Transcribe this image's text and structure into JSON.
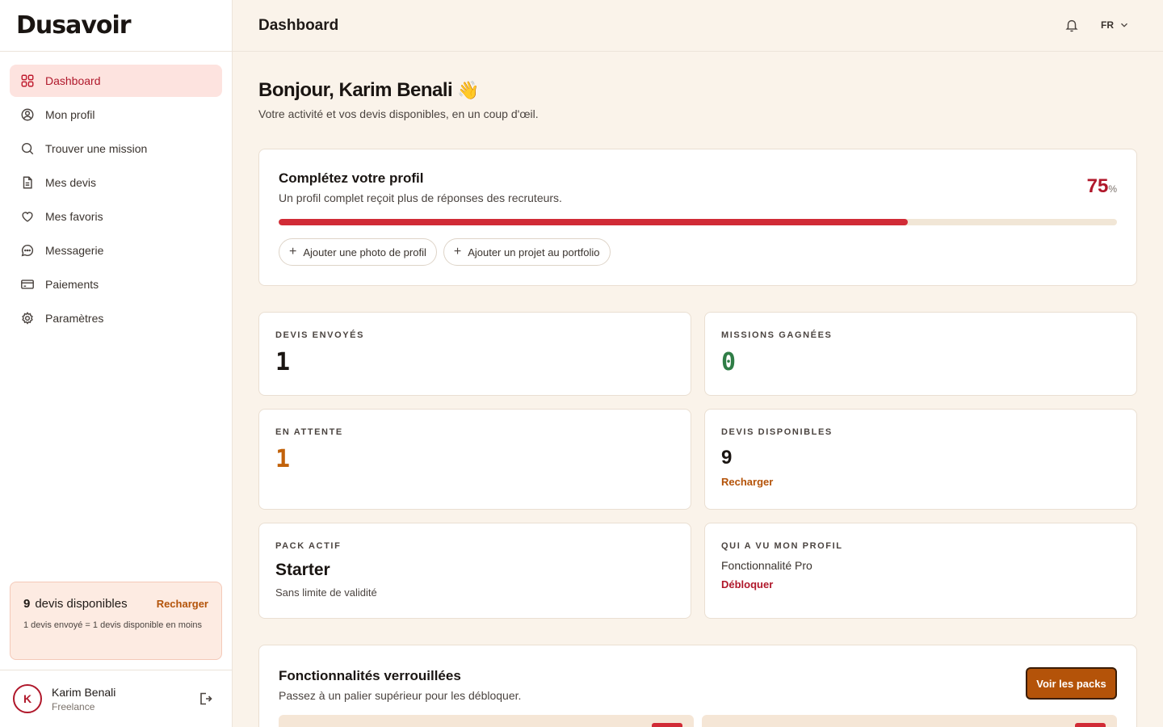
{
  "brand": {
    "logo": "Dusavoir"
  },
  "sidebar": {
    "items": [
      {
        "label": "Dashboard",
        "icon": "grid-icon",
        "active": true
      },
      {
        "label": "Mon profil",
        "icon": "user-circle-icon"
      },
      {
        "label": "Trouver une mission",
        "icon": "search-icon"
      },
      {
        "label": "Mes devis",
        "icon": "document-icon"
      },
      {
        "label": "Mes favoris",
        "icon": "heart-icon"
      },
      {
        "label": "Messagerie",
        "icon": "chat-icon"
      },
      {
        "label": "Paiements",
        "icon": "credit-card-icon"
      },
      {
        "label": "Paramètres",
        "icon": "gear-icon"
      }
    ],
    "credits": {
      "count": "9",
      "label": "devis disponibles",
      "link": "Recharger",
      "note": "1 devis envoyé = 1 devis disponible en moins"
    },
    "user": {
      "initial": "K",
      "name": "Karim Benali",
      "role": "Freelance"
    }
  },
  "header": {
    "title": "Dashboard",
    "lang": "FR"
  },
  "main": {
    "greeting": "Bonjour, Karim Benali",
    "greeting_emoji": "👋",
    "subtitle": "Votre activité et vos devis disponibles, en un coup d'œil.",
    "profile": {
      "title": "Complétez votre profil",
      "subtitle": "Un profil complet reçoit plus de réponses des recruteurs.",
      "percent": "75",
      "percent_unit": "%",
      "progress": 0.75,
      "actions": [
        "Ajouter une photo de profil",
        "Ajouter un projet au portfolio"
      ]
    },
    "stats": {
      "sent": {
        "label": "Devis envoyés",
        "value": "1"
      },
      "won": {
        "label": "Missions gagnées",
        "value": "0"
      },
      "pending": {
        "label": "En attente",
        "value": "1"
      },
      "available": {
        "label": "Devis disponibles",
        "value": "9",
        "link": "Recharger"
      },
      "pack": {
        "label": "Pack actif",
        "value": "Starter",
        "note": "Sans limite de validité"
      },
      "views": {
        "label": "Qui a vu mon profil",
        "note": "Fonctionnalité Pro",
        "link": "Débloquer"
      }
    },
    "locked": {
      "title": "Fonctionnalités verrouillées",
      "subtitle": "Passez à un palier supérieur pour les débloquer.",
      "button": "Voir les packs"
    }
  },
  "colors": {
    "accent": "#b0182b",
    "orange": "#b45309",
    "green": "#2f7d46",
    "background": "#faf3ea"
  }
}
